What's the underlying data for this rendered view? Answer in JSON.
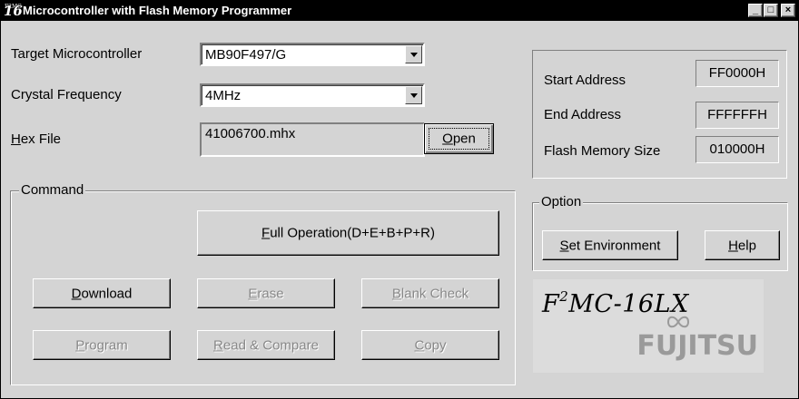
{
  "window": {
    "title": "Microcontroller with Flash Memory Programmer",
    "icon_text": "16",
    "icon_caption": "F2MC",
    "controls": {
      "minimize": "_",
      "maximize": "□",
      "close": "×"
    }
  },
  "target": {
    "label": "Target Microcontroller",
    "value": "MB90F497/G"
  },
  "crystal": {
    "label": "Crystal Frequency",
    "value": "4MHz"
  },
  "hexfile": {
    "label_mnemonic": "H",
    "label_rest": "ex File",
    "value": "41006700.mhx",
    "open_mnemonic": "O",
    "open_rest": "pen"
  },
  "address_info": {
    "start_label": "Start Address",
    "start_value": "FF0000H",
    "end_label": "End Address",
    "end_value": "FFFFFFH",
    "size_label": "Flash Memory Size",
    "size_value": "010000H"
  },
  "command": {
    "group_title": "Command",
    "full_operation": {
      "mnemonic": "F",
      "rest": "ull Operation(D+E+B+P+R)",
      "enabled": true
    },
    "download": {
      "mnemonic": "D",
      "rest": "ownload",
      "enabled": true
    },
    "erase": {
      "mnemonic": "E",
      "rest": "rase",
      "enabled": false
    },
    "blank_check": {
      "mnemonic": "B",
      "rest": "lank Check",
      "enabled": false
    },
    "program": {
      "mnemonic": "P",
      "rest": "rogram",
      "enabled": false
    },
    "read_compare": {
      "mnemonic": "R",
      "rest": "ead & Compare",
      "enabled": false
    },
    "copy": {
      "mnemonic": "C",
      "rest": "opy",
      "enabled": false
    }
  },
  "option": {
    "group_title": "Option",
    "set_env": {
      "mnemonic": "S",
      "rest": "et Environment"
    },
    "help": {
      "mnemonic": "H",
      "rest": "elp"
    }
  },
  "logo": {
    "product_pre": "F",
    "product_sup": "2",
    "product_post": "MC-16LX",
    "brand": "FUJITSU"
  },
  "colors": {
    "face": "#d4d4d4",
    "titlebar": "#000000",
    "disabled_text": "#888888",
    "logo_bg": "#dcdcdc",
    "brand_gray": "#9a9a9a"
  }
}
